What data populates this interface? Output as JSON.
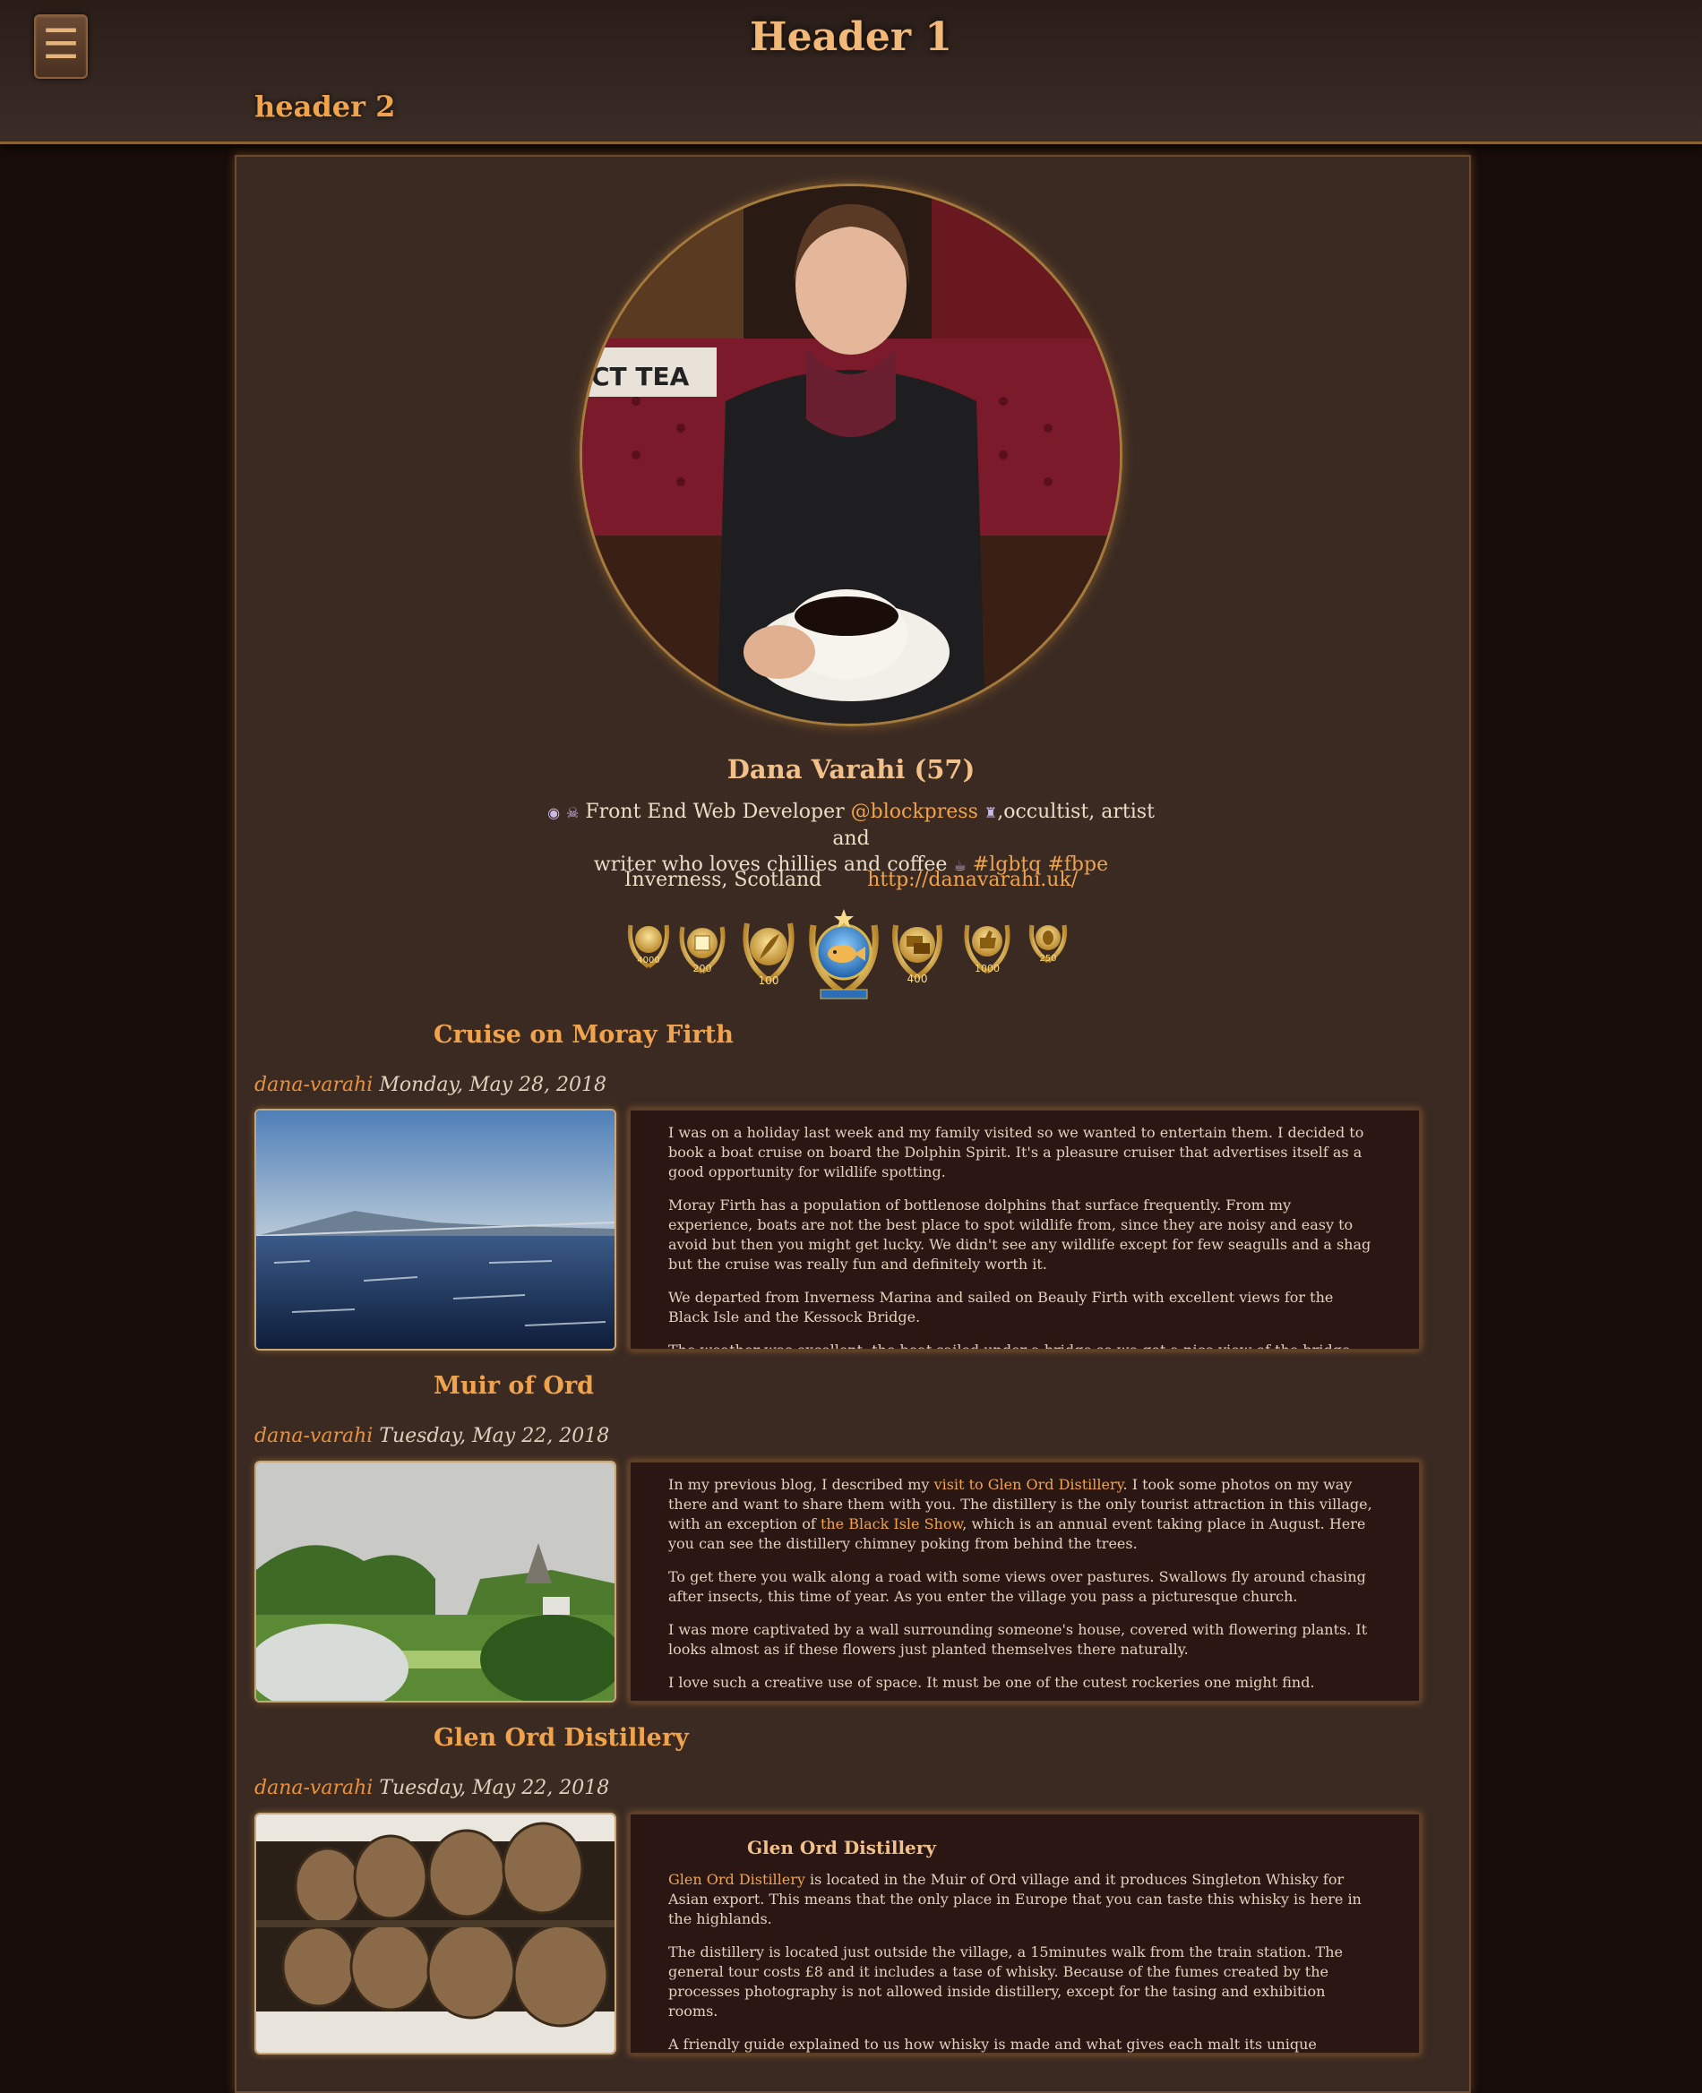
{
  "header": {
    "menu_icon": "☰",
    "title": "Header 1",
    "subtitle": "header 2"
  },
  "profile": {
    "name": "Dana Varahi (57)",
    "bio_line1_pre": "Front End Web Developer",
    "bio_handle": "@blockpress",
    "bio_line1_post": ",occultist, artist and",
    "bio_line2": "writer who loves chillies and coffee",
    "tags": [
      "#lgbtq",
      "#fbpe"
    ],
    "location": "Inverness, Scotland",
    "website": "http://danavarahi.uk/",
    "badges": [
      "4000",
      "200",
      "100",
      "",
      "400",
      "1000",
      "250"
    ]
  },
  "posts": [
    {
      "title": "Cruise on Moray Firth",
      "author": "dana-varahi",
      "date": "Monday, May 28, 2018",
      "paragraphs": [
        "I was on a holiday last week and my family visited so we wanted to entertain them. I decided to book a boat cruise on board the Dolphin Spirit. It's a pleasure cruiser that advertises itself as a good opportunity for wildlife spotting.",
        "Moray Firth has a population of bottlenose dolphins that surface frequently. From my experience, boats are not the best place to spot wildlife from, since they are noisy and easy to avoid but then you might get lucky. We didn't see any wildlife except for few seagulls and a shag but the cruise was really fun and definitely worth it.",
        "We departed from Inverness Marina and sailed on Beauly Firth with excellent views for the Black Isle and the Kessock Bridge.",
        "The weather was excellent, the boat sailed under a bridge so we got a nice view of the bridge."
      ]
    },
    {
      "title": "Muir of Ord",
      "author": "dana-varahi",
      "date": "Tuesday, May 22, 2018",
      "p1_pre": "In my previous blog, I described my ",
      "p1_link1": "visit to Glen Ord Distillery",
      "p1_mid": ". I took some photos on my way there and want to share them with you. The distillery is the only tourist attraction in this village, with an exception of ",
      "p1_link2": "the Black Isle Show",
      "p1_post": ", which is an annual event taking place in August. Here you can see the distillery chimney poking from behind the trees.",
      "paragraphs": [
        "To get there you walk along a road with some views over pastures. Swallows fly around chasing after insects, this time of year. As you enter the village you pass a picturesque church.",
        "I was more captivated by a wall surrounding someone's house, covered with flowering plants. It looks almost as if these flowers just planted themselves there naturally.",
        "I love such a creative use of space. It must be one of the cutest rockeries one might find."
      ]
    },
    {
      "title": "Glen Ord Distillery",
      "author": "dana-varahi",
      "date": "Tuesday, May 22, 2018",
      "heading": "Glen Ord Distillery",
      "p1_link": "Glen Ord Distillery",
      "p1_post": " is located in the Muir of Ord village and it produces Singleton Whisky for Asian export. This means that the only place in Europe that you can taste this whisky is here in the highlands.",
      "paragraphs": [
        "The distillery is located just outside the village, a 15minutes walk from the train station. The general tour costs £8 and it includes a tase of whisky. Because of the fumes created by the processes photography is not allowed inside distillery, except for the tasing and exhibition rooms.",
        "A friendly guide explained to us how whisky is made and what gives each malt its unique flavours. It all starts with the grains germination, peat smoke and grinding. Here you see all of the ingredients used in making whisky."
      ]
    }
  ]
}
